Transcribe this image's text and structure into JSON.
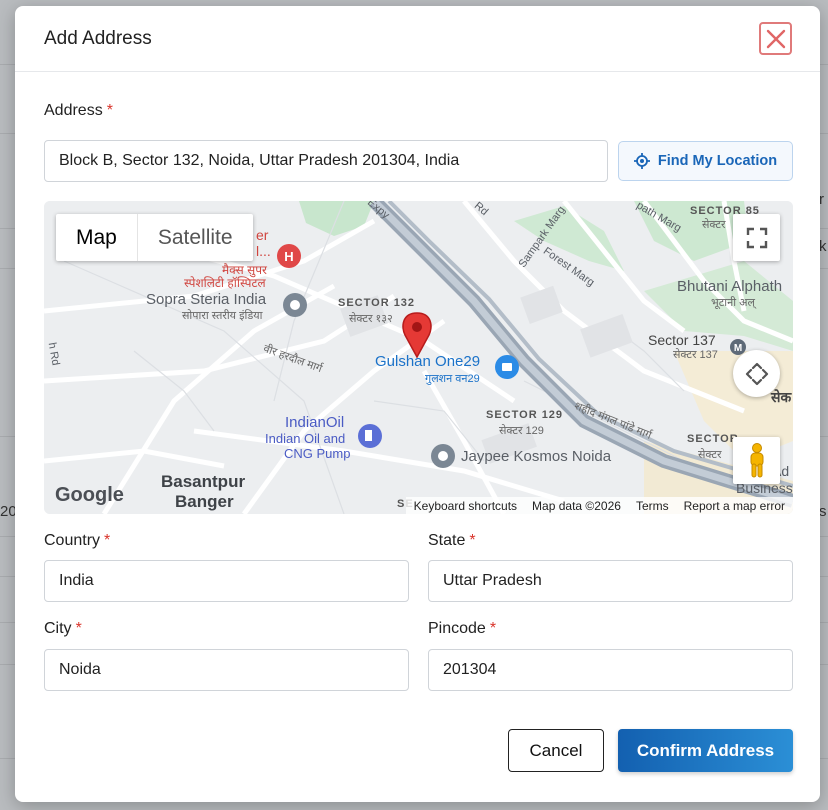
{
  "modal": {
    "title": "Add Address",
    "close_icon": "close-icon"
  },
  "address": {
    "label": "Address",
    "required_mark": "*",
    "value": "Block B, Sector 132, Noida, Uttar Pradesh 201304, India",
    "find_button_label": "Find My Location",
    "find_icon": "crosshair-icon"
  },
  "map": {
    "type_options": [
      "Map",
      "Satellite"
    ],
    "selected_type": "Map",
    "labels": {
      "hospital_en_1": "er",
      "hospital_en_2": "l...",
      "hospital_hi_1": "मैक्स सुपर",
      "hospital_hi_2": "स्पेशलिटी हॉस्पिटल",
      "sopra_en": "Sopra Steria India",
      "sopra_hi": "सोपारा स्तरीय इंडिया",
      "sector132_en": "SECTOR 132",
      "sector132_hi": "सेक्टर १३२",
      "veer_hi": "वीर हरदौल मार्ग",
      "gulshan_en": "Gulshan One29",
      "gulshan_hi": "गुलशन वन29",
      "indianoil_en": "IndianOil",
      "indianoil_sub1": "Indian Oil and",
      "indianoil_sub2": "CNG Pump",
      "sector129_en": "SECTOR 129",
      "sector129_hi": "सेक्टर 129",
      "jaypee": "Jaypee Kosmos Noida",
      "basantpur_1": "Basantpur",
      "basantpur_2": "Banger",
      "sampark": "Sampark Marg",
      "forest": "Forest Marg",
      "pathmarg": "path Marg",
      "expy": "Expy",
      "rd_top": "Rd",
      "rd_left": "h Rd",
      "sector85_en": "SECTOR 85",
      "sector85_hi": "सेक्टर",
      "bhutani_en": "Bhutani Alphath",
      "bhutani_hi": "भूटानी अल्",
      "sector137_en": "Sector 137",
      "sector137_hi": "सेक्टर 137",
      "shaheed_hi": "शहीद मंगल पांडे मार्ग",
      "sector_bottom_right": "SECTOR",
      "sector_bottom_right_hi": "सेक्टर",
      "business_1": "Ad",
      "business_2": "Business P",
      "se_bottom": "SE",
      "sek_right": "सेक"
    },
    "google_logo": "Google",
    "attribution": [
      "Keyboard shortcuts",
      "Map data ©2026",
      "Terms",
      "Report a map error"
    ]
  },
  "form": {
    "country": {
      "label": "Country",
      "value": "India"
    },
    "state": {
      "label": "State",
      "value": "Uttar Pradesh"
    },
    "city": {
      "label": "City",
      "value": "Noida"
    },
    "pincode": {
      "label": "Pincode",
      "value": "201304"
    }
  },
  "actions": {
    "cancel_label": "Cancel",
    "confirm_label": "Confirm Address"
  },
  "background": {
    "fragment_1": "20",
    "fragment_2": "s",
    "fragment_3": "k",
    "fragment_4": "r"
  },
  "colors": {
    "accent": "#1a66b8",
    "required": "#d9342b",
    "pin": "#e53935"
  }
}
